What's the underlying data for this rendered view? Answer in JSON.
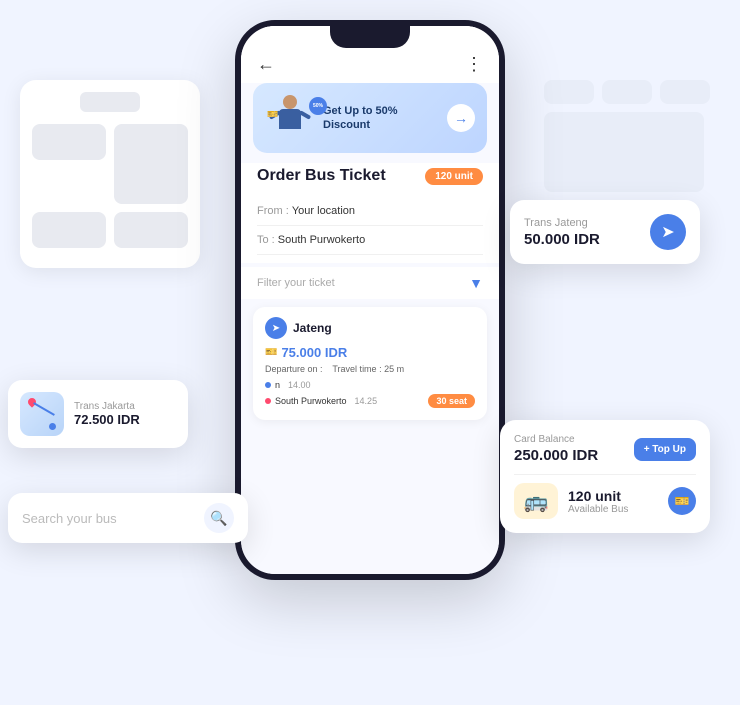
{
  "app": {
    "title": "Order Bus Ticket"
  },
  "banner": {
    "title": "Get Up to\n50% Discount",
    "discount": "50%"
  },
  "header": {
    "unit_badge": "120 unit"
  },
  "form": {
    "from_label": "From : ",
    "from_value": "Your location",
    "to_label": "To : ",
    "to_value": "South Purwokerto",
    "filter_placeholder": "Filter your ticket"
  },
  "route": {
    "name": "Jateng",
    "price": "75.000 IDR",
    "departure_label": "Departure on :",
    "travel_label": "Travel time :",
    "travel_time": "25 m",
    "stops": [
      {
        "name": "n",
        "time": "14.00",
        "type": "blue"
      },
      {
        "name": "South Purwokerto",
        "time": "14.25",
        "type": "red"
      }
    ],
    "seat": "30 seat"
  },
  "cards": {
    "trans_jateng": {
      "label": "Trans Jateng",
      "price": "50.000 IDR"
    },
    "trans_jakarta": {
      "label": "Trans Jakarta",
      "price": "72.500 IDR"
    },
    "balance": {
      "label": "Card Balance",
      "value": "250.000 IDR",
      "topup_label": "+ Top Up"
    },
    "bus": {
      "units": "120 unit",
      "label": "Available Bus"
    }
  },
  "search": {
    "placeholder": "Search your bus"
  },
  "icons": {
    "back": "←",
    "dots": "⋮",
    "arrow_right": "→",
    "navigate": "➤",
    "filter": "⊿",
    "search": "🔍",
    "ticket": "🎫"
  }
}
